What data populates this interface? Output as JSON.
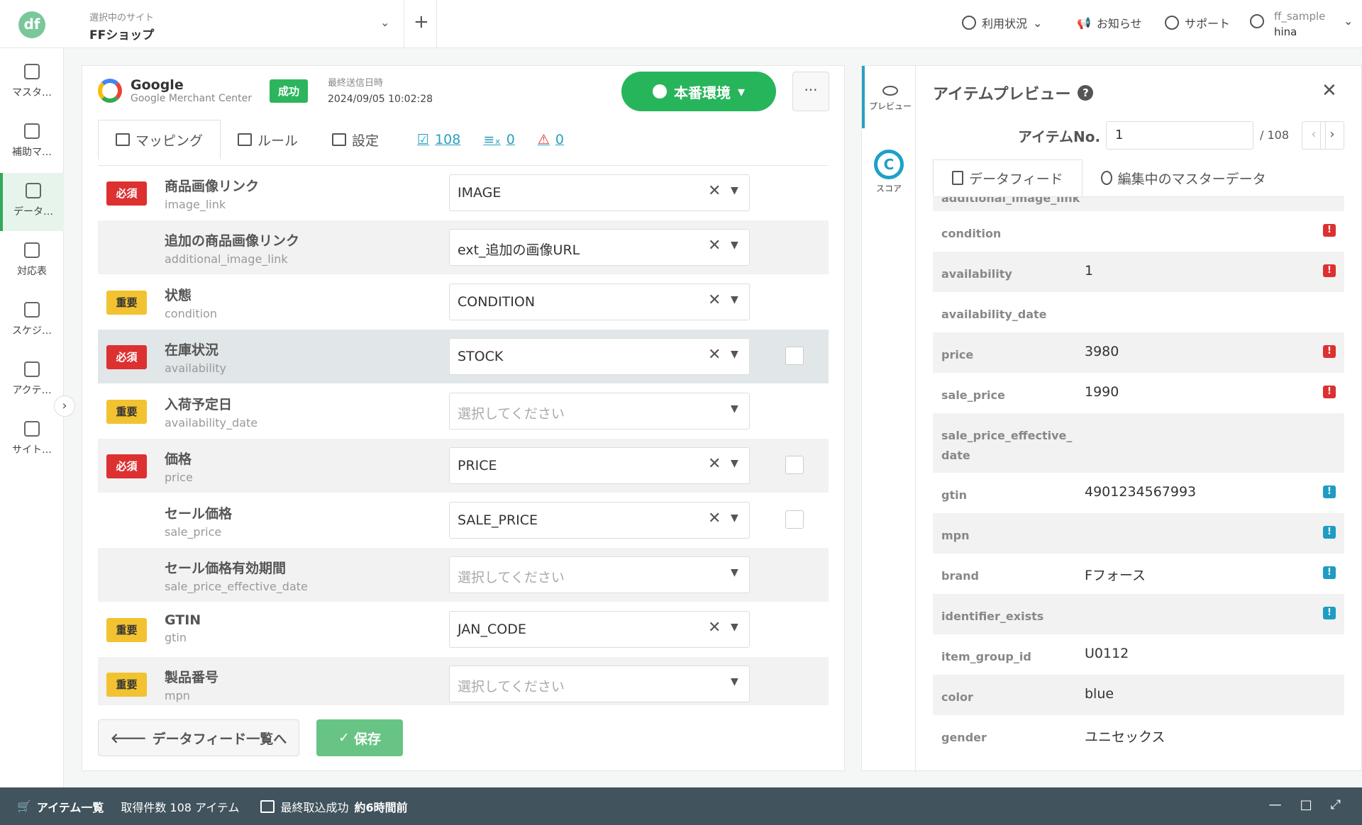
{
  "app": {
    "logo": "df"
  },
  "site": {
    "label": "選択中のサイト",
    "name": "FFショップ"
  },
  "topnav": {
    "usage": "利用状況",
    "news": "お知らせ",
    "support": "サポート"
  },
  "user": {
    "account": "ff_sample",
    "name": "hina"
  },
  "sidebar": {
    "items": [
      {
        "label": "マスタ…",
        "icon": "database-icon"
      },
      {
        "label": "補助マ…",
        "icon": "database-plus-icon"
      },
      {
        "label": "データ…",
        "icon": "document-icon"
      },
      {
        "label": "対応表",
        "icon": "table-icon"
      },
      {
        "label": "スケジ…",
        "icon": "calendar-clock-icon"
      },
      {
        "label": "アクテ…",
        "icon": "history-icon"
      },
      {
        "label": "サイト…",
        "icon": "sliders-icon"
      }
    ]
  },
  "feed": {
    "name": "Google",
    "sub": "Google Merchant Center",
    "status": "成功",
    "sent_label": "最終送信日時",
    "sent_at": "2024/09/05 10:02:28",
    "env": "本番環境"
  },
  "tabs": {
    "mapping": "マッピング",
    "rules": "ルール",
    "settings": "設定",
    "count_ok": "108",
    "count_x": "0",
    "count_warn": "0"
  },
  "rows": [
    {
      "badge": "必須",
      "jp": "商品画像リンク",
      "en": "image_link",
      "value": "IMAGE"
    },
    {
      "badge": "",
      "jp": "追加の商品画像リンク",
      "en": "additional_image_link",
      "value": "ext_追加の画像URL"
    },
    {
      "badge": "重要",
      "jp": "状態",
      "en": "condition",
      "value": "CONDITION"
    },
    {
      "badge": "必須",
      "jp": "在庫状況",
      "en": "availability",
      "value": "STOCK"
    },
    {
      "badge": "重要",
      "jp": "入荷予定日",
      "en": "availability_date",
      "value": "選択してください"
    },
    {
      "badge": "必須",
      "jp": "価格",
      "en": "price",
      "value": "PRICE"
    },
    {
      "badge": "",
      "jp": "セール価格",
      "en": "sale_price",
      "value": "SALE_PRICE"
    },
    {
      "badge": "",
      "jp": "セール価格有効期間",
      "en": "sale_price_effective_date",
      "value": "選択してください"
    },
    {
      "badge": "重要",
      "jp": "GTIN",
      "en": "gtin",
      "value": "JAN_CODE"
    },
    {
      "badge": "重要",
      "jp": "製品番号",
      "en": "mpn",
      "value": "選択してください"
    }
  ],
  "buttons": {
    "back": "データフィード一覧へ",
    "save": "保存"
  },
  "preview": {
    "tab_preview": "プレビュー",
    "tab_score": "スコア",
    "score_letter": "C",
    "title": "アイテムプレビュー",
    "item_label": "アイテムNo.",
    "item_no": "1",
    "item_total": "/ 108",
    "tab_feed": "データフィード",
    "tab_master": "編集中のマスターデータ",
    "items": [
      {
        "k": "additional_image_link",
        "v": ""
      },
      {
        "k": "condition",
        "v": "",
        "flag": "red"
      },
      {
        "k": "availability",
        "v": "1",
        "flag": "red"
      },
      {
        "k": "availability_date",
        "v": ""
      },
      {
        "k": "price",
        "v": "3980",
        "flag": "red"
      },
      {
        "k": "sale_price",
        "v": "1990",
        "flag": "red"
      },
      {
        "k": "sale_price_effective_ date",
        "v": ""
      },
      {
        "k": "gtin",
        "v": "4901234567993",
        "flag": "blue"
      },
      {
        "k": "mpn",
        "v": "",
        "flag": "blue"
      },
      {
        "k": "brand",
        "v": "Fフォース",
        "flag": "blue"
      },
      {
        "k": "identifier_exists",
        "v": "",
        "flag": "blue"
      },
      {
        "k": "item_group_id",
        "v": "U0112"
      },
      {
        "k": "color",
        "v": "blue"
      },
      {
        "k": "gender",
        "v": "ユニセックス"
      }
    ]
  },
  "bottombar": {
    "items": "アイテム一覧",
    "count": "取得件数 108 アイテム",
    "last_label": "最終取込成功",
    "last_value": "約6時間前"
  },
  "colors": {
    "accent": "#27b55c",
    "must": "#dd3030",
    "important": "#f2c230",
    "info": "#1e9cc2",
    "bottom": "#41535c"
  }
}
